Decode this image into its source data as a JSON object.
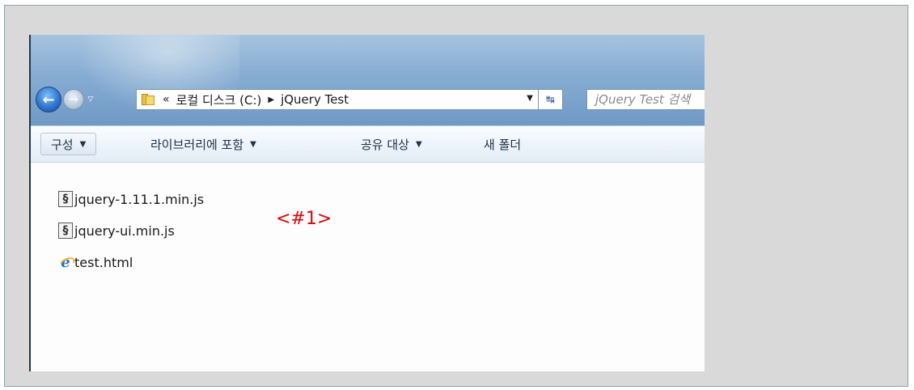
{
  "address_bar": {
    "overflow_chevron": "«",
    "path_segments": [
      "로컬 디스크 (C:)",
      "jQuery Test"
    ],
    "search_placeholder": "jQuery Test 검색"
  },
  "toolbar": {
    "items": [
      {
        "label": "구성"
      },
      {
        "label": "라이브러리에 포함"
      },
      {
        "label": "공유 대상"
      },
      {
        "label": "새 폴더"
      }
    ]
  },
  "files": [
    {
      "name": "jquery-1.11.1.min.js",
      "icon": "script-file-icon"
    },
    {
      "name": "jquery-ui.min.js",
      "icon": "script-file-icon"
    },
    {
      "name": "test.html",
      "icon": "ie-html-file-icon"
    }
  ],
  "annotation": {
    "text": "<#1>",
    "color": "#e60000"
  }
}
